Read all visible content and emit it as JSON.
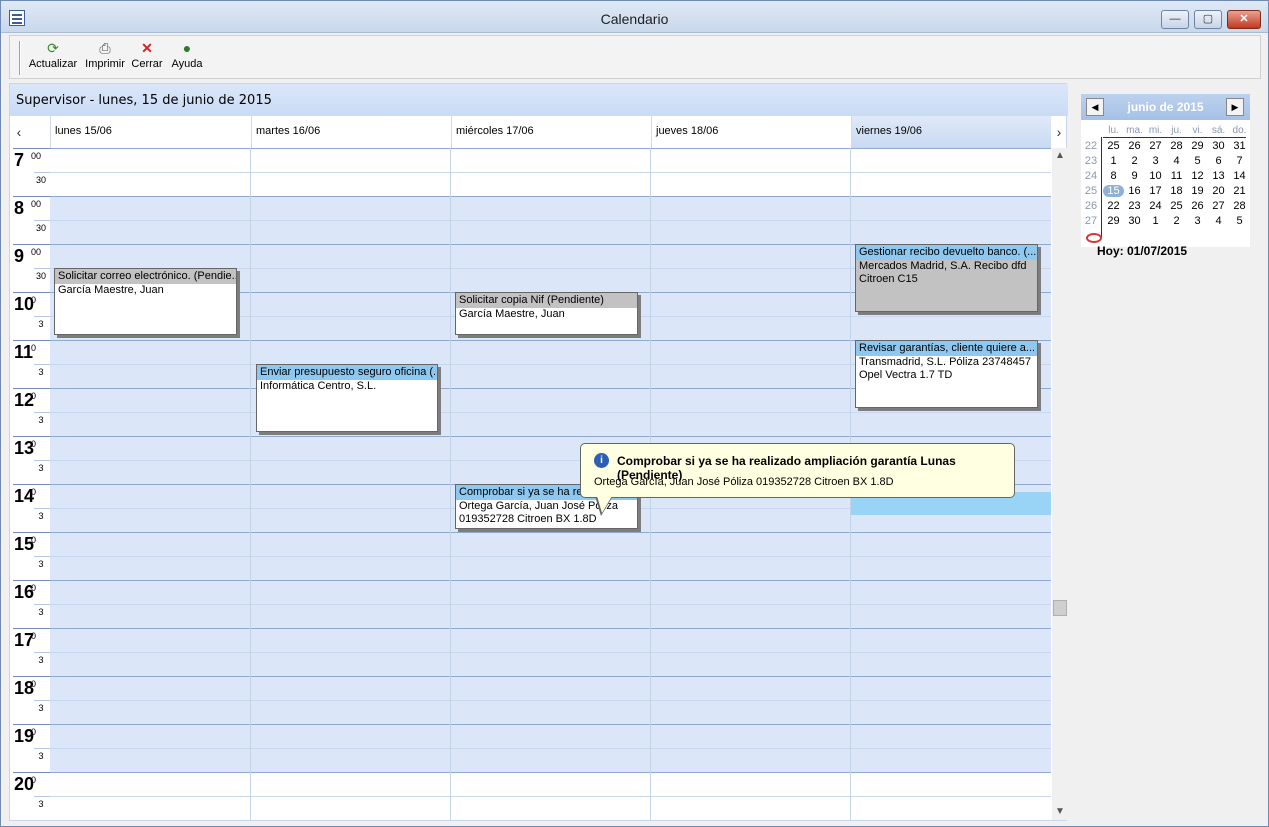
{
  "window": {
    "title": "Calendario",
    "minimize": "—",
    "maximize": "▢",
    "close": "✕"
  },
  "toolbar": [
    {
      "name": "refresh",
      "label": "Actualizar",
      "icon": "refresh-icon"
    },
    {
      "name": "print",
      "label": "Imprimir",
      "icon": "printer-icon"
    },
    {
      "name": "close",
      "label": "Cerrar",
      "icon": "close-icon"
    },
    {
      "name": "help",
      "label": "Ayuda",
      "icon": "help-icon"
    }
  ],
  "header": {
    "title": "Supervisor - lunes, 15 de junio de 2015"
  },
  "nav": {
    "prev": "‹",
    "next": "›"
  },
  "days": [
    "lunes 15/06",
    "martes 16/06",
    "miércoles 17/06",
    "jueves 18/06",
    "viernes 19/06"
  ],
  "hours": [
    {
      "h": "7",
      "sup": "00",
      "half": "30"
    },
    {
      "h": "8",
      "sup": "00",
      "half": "30"
    },
    {
      "h": "9",
      "sup": "00",
      "half": "30"
    },
    {
      "h": "10",
      "sup": "0",
      "half": "3"
    },
    {
      "h": "11",
      "sup": "0",
      "half": "3"
    },
    {
      "h": "12",
      "sup": "0",
      "half": "3"
    },
    {
      "h": "13",
      "sup": "0",
      "half": "3"
    },
    {
      "h": "14",
      "sup": "0",
      "half": "3"
    },
    {
      "h": "15",
      "sup": "0",
      "half": "3"
    },
    {
      "h": "16",
      "sup": "0",
      "half": "3"
    },
    {
      "h": "17",
      "sup": "0",
      "half": "3"
    },
    {
      "h": "18",
      "sup": "0",
      "half": "3"
    },
    {
      "h": "19",
      "sup": "0",
      "half": "3"
    },
    {
      "h": "20",
      "sup": "0",
      "half": "3"
    }
  ],
  "appointments": [
    {
      "title": "Solicitar correo electrónico. (Pendie...",
      "detail": "García Maestre, Juan",
      "style": "gray"
    },
    {
      "title": "Solicitar copia Nif (Pendiente)",
      "detail": "García Maestre, Juan",
      "style": "gray"
    },
    {
      "title": "Enviar presupuesto seguro oficina (...",
      "detail": "Informática Centro, S.L.",
      "style": "blue"
    },
    {
      "title": "Comprobar si ya se ha realizado",
      "detail": "Ortega García, Juan José Póliza 019352728 Citroen BX 1.8D",
      "style": "blue"
    },
    {
      "title": "Gestionar recibo devuelto banco. (...",
      "detail": "Mercados Madrid, S.A. Recibo dfd Citroen C15",
      "style": "blue"
    },
    {
      "title": "Revisar garantías, cliente quiere a...",
      "detail": "Transmadrid, S.L. Póliza 23748457 Opel Vectra 1.7 TD",
      "style": "blue"
    }
  ],
  "tooltip": {
    "title": "Comprobar si ya se ha realizado ampliación garantía Lunas (Pendiente)",
    "detail": "Ortega García, Juan José Póliza 019352728 Citroen BX 1.8D",
    "icon": "info-icon"
  },
  "minical": {
    "title": "junio de 2015",
    "prev": "◀",
    "next": "▶",
    "dow": [
      "lu.",
      "ma.",
      "mi.",
      "ju.",
      "vi.",
      "sá.",
      "do."
    ],
    "weeks": [
      {
        "wk": "22",
        "days": [
          "25",
          "26",
          "27",
          "28",
          "29",
          "30",
          "31"
        ]
      },
      {
        "wk": "23",
        "days": [
          "1",
          "2",
          "3",
          "4",
          "5",
          "6",
          "7"
        ]
      },
      {
        "wk": "24",
        "days": [
          "8",
          "9",
          "10",
          "11",
          "12",
          "13",
          "14"
        ]
      },
      {
        "wk": "25",
        "days": [
          "15",
          "16",
          "17",
          "18",
          "19",
          "20",
          "21"
        ]
      },
      {
        "wk": "26",
        "days": [
          "22",
          "23",
          "24",
          "25",
          "26",
          "27",
          "28"
        ]
      },
      {
        "wk": "27",
        "days": [
          "29",
          "30",
          "1",
          "2",
          "3",
          "4",
          "5"
        ]
      }
    ],
    "today": "Hoy: 01/07/2015"
  },
  "colors": {
    "work": "#dbe7f8",
    "accent": "#8ec8f0",
    "gray": "#c2c2c2",
    "today_ring": "#d33333"
  }
}
